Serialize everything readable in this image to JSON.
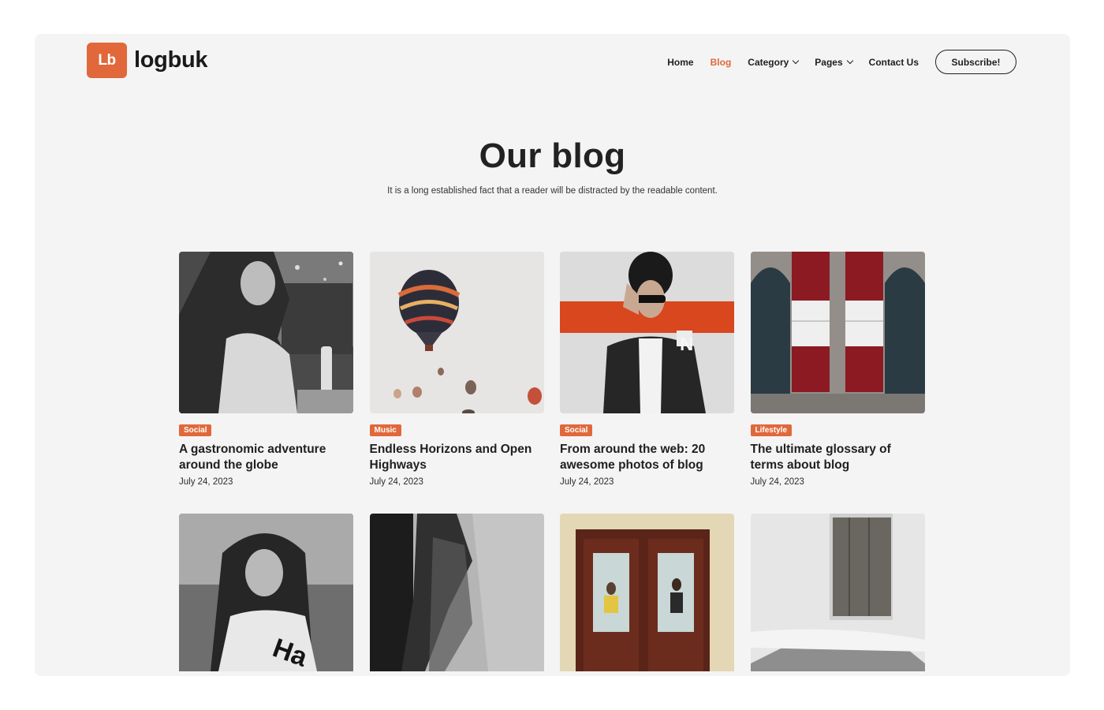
{
  "brand": {
    "badge": "Lb",
    "name": "logbuk",
    "accent": "#e0683b"
  },
  "nav": {
    "items": [
      {
        "label": "Home",
        "active": false,
        "dropdown": false
      },
      {
        "label": "Blog",
        "active": true,
        "dropdown": false
      },
      {
        "label": "Category",
        "active": false,
        "dropdown": true
      },
      {
        "label": "Pages",
        "active": false,
        "dropdown": true
      },
      {
        "label": "Contact Us",
        "active": false,
        "dropdown": false
      }
    ],
    "subscribe_label": "Subscribe!"
  },
  "hero": {
    "title": "Our blog",
    "subtitle": "It is a long established fact that a reader will be distracted by the readable content."
  },
  "posts": [
    {
      "category": "Social",
      "title": "A gastronomic adventure around the globe",
      "date": "July 24, 2023",
      "image": "woman-window-photo"
    },
    {
      "category": "Music",
      "title": "Endless Horizons and Open Highways",
      "date": "July 24, 2023",
      "image": "hot-air-balloons-photo"
    },
    {
      "category": "Social",
      "title": "From around the web: 20 awesome photos of blog",
      "date": "July 24, 2023",
      "image": "man-varsity-jacket-photo"
    },
    {
      "category": "Lifestyle",
      "title": "The ultimate glossary of terms about blog",
      "date": "July 24, 2023",
      "image": "red-shutters-photo"
    }
  ],
  "posts_row2": [
    {
      "image": "woman-portrait-photo"
    },
    {
      "image": "motion-blur-person-photo"
    },
    {
      "image": "wooden-doors-couple-photo"
    },
    {
      "image": "white-wall-door-photo"
    }
  ]
}
